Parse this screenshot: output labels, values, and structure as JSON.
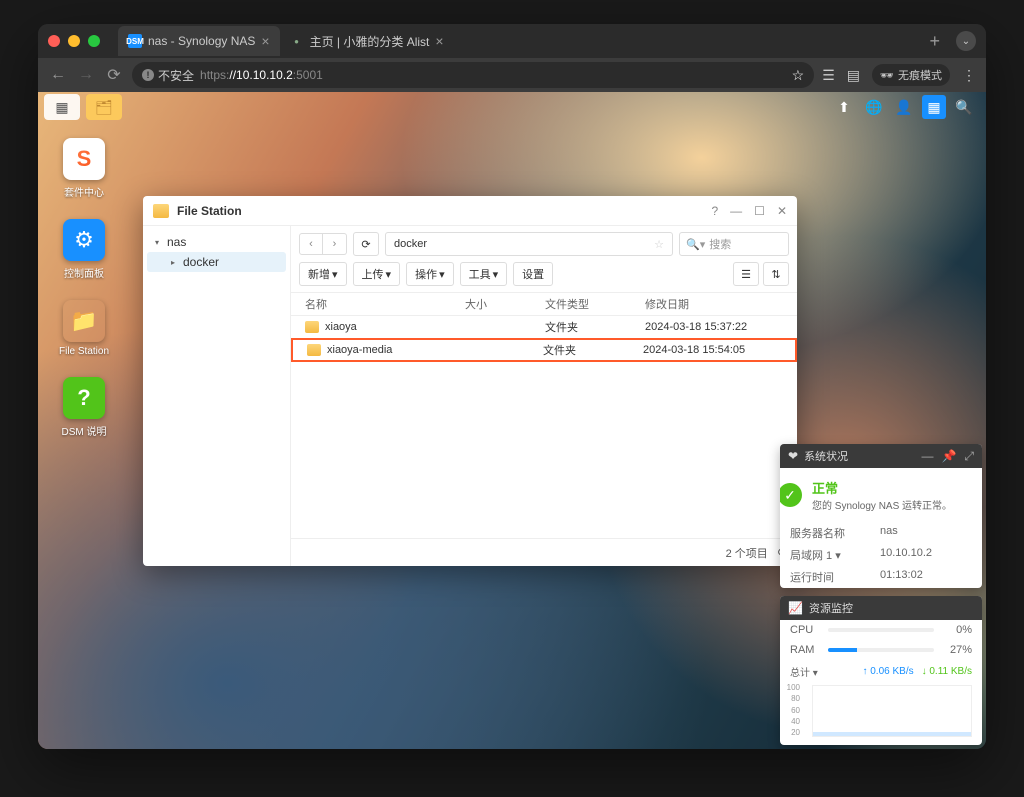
{
  "browser": {
    "tabs": [
      {
        "label": "nas - Synology NAS",
        "active": true,
        "favicon_text": "DSM",
        "favicon_bg": "#1890ff",
        "favicon_color": "#fff"
      },
      {
        "label": "主页 | 小雅的分类 Alist",
        "active": false,
        "favicon_text": "●",
        "favicon_bg": "transparent",
        "favicon_color": "#8a8"
      }
    ],
    "url_insecure": "不安全",
    "url_prefix": "https:",
    "url_host": "//10.10.10.2",
    "url_port": ":5001",
    "incognito_label": "无痕模式"
  },
  "desktop_icons": [
    {
      "label": "套件中心",
      "bg": "#fff",
      "emoji": "S",
      "emoji_style": "background:linear-gradient(135deg,#ff7a45,#fa541c);-webkit-background-clip:text;color:transparent;font-weight:bold;"
    },
    {
      "label": "控制面板",
      "bg": "#1890ff",
      "emoji": "⚙",
      "emoji_style": "color:#fff;"
    },
    {
      "label": "File Station",
      "bg": "transparent",
      "emoji": "📁",
      "emoji_style": ""
    },
    {
      "label": "DSM 说明",
      "bg": "#52c41a",
      "emoji": "?",
      "emoji_style": "color:#fff;font-weight:bold;"
    }
  ],
  "fs": {
    "title": "File Station",
    "tree": {
      "root": "nas",
      "child": "docker"
    },
    "path": "docker",
    "search_placeholder": "搜索",
    "actions": {
      "create": "新增",
      "upload": "上传",
      "ops": "操作",
      "tools": "工具",
      "settings": "设置"
    },
    "columns": {
      "name": "名称",
      "size": "大小",
      "type": "文件类型",
      "date": "修改日期"
    },
    "rows": [
      {
        "name": "xiaoya",
        "type": "文件夹",
        "date": "2024-03-18 15:37:22",
        "highlighted": false
      },
      {
        "name": "xiaoya-media",
        "type": "文件夹",
        "date": "2024-03-18 15:54:05",
        "highlighted": true
      }
    ],
    "footer_count": "2 个项目"
  },
  "widgets": {
    "health": {
      "title": "系统状况",
      "status": "正常",
      "sub": "您的 Synology NAS 运转正常。",
      "rows": [
        {
          "k": "服务器名称",
          "v": "nas"
        },
        {
          "k": "局域网 1 ▾",
          "v": "10.10.10.2"
        },
        {
          "k": "运行时间",
          "v": "01:13:02"
        }
      ]
    },
    "resource": {
      "title": "资源监控",
      "rows": [
        {
          "k": "CPU",
          "pct": 0,
          "v": "0%"
        },
        {
          "k": "RAM",
          "pct": 27,
          "v": "27%"
        }
      ],
      "net": {
        "label": "总计 ▾",
        "up": "0.06 KB/s",
        "dn": "0.11 KB/s"
      },
      "y_labels": [
        "100",
        "80",
        "60",
        "40",
        "20"
      ]
    }
  }
}
